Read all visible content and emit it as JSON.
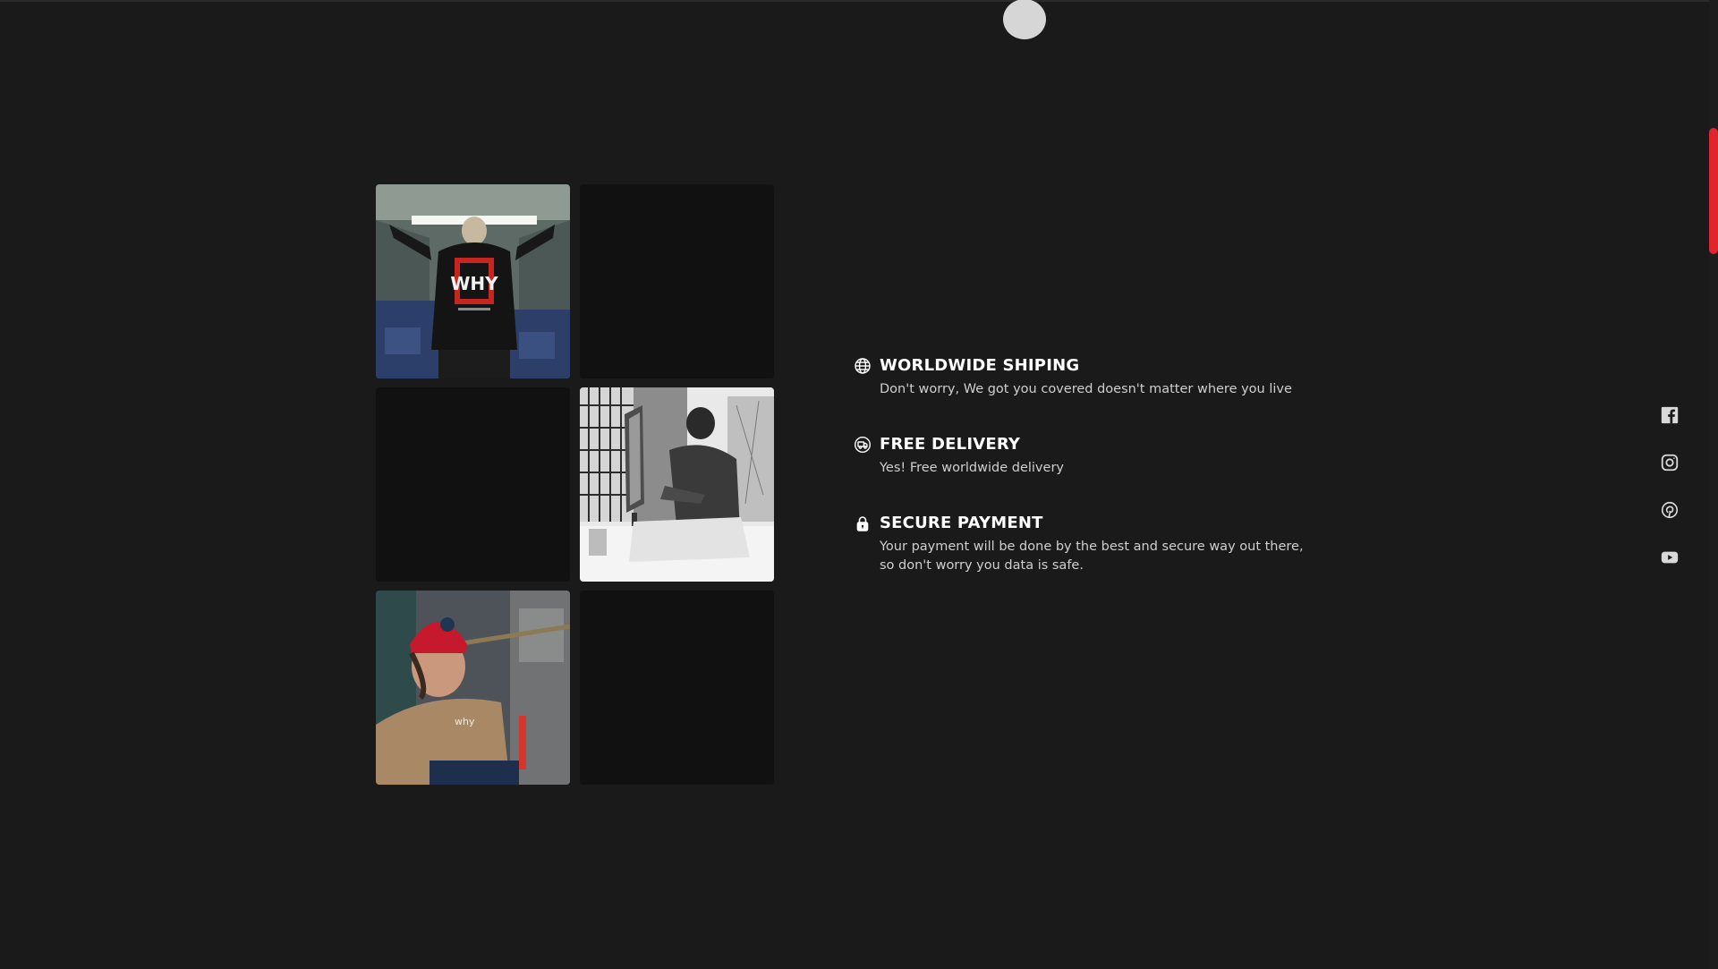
{
  "features": [
    {
      "icon": "globe-icon",
      "title": "WORLDWIDE SHIPING",
      "text": "Don't worry, We got you covered doesn't matter where you live"
    },
    {
      "icon": "delivery-truck-icon",
      "title": "FREE DELIVERY",
      "text": "Yes! Free worldwide delivery"
    },
    {
      "icon": "lock-icon",
      "title": "SECURE PAYMENT",
      "text": "Your payment will be done by the best and secure way out there, so don't worry you data is safe."
    }
  ],
  "gallery": {
    "tiles": [
      {
        "type": "photo",
        "subject": "person in black WHY hoodie on train"
      },
      {
        "type": "empty"
      },
      {
        "type": "empty"
      },
      {
        "type": "photo",
        "subject": "black and white person at desk with computer"
      },
      {
        "type": "photo",
        "subject": "person in red beanie and tan WHY hoodie on steps"
      },
      {
        "type": "empty"
      }
    ]
  },
  "social": [
    "facebook-icon",
    "instagram-icon",
    "pinterest-icon",
    "youtube-icon"
  ],
  "colors": {
    "background": "#1a1a1a",
    "accent": "#e0262b",
    "empty_tile": "#111111"
  }
}
